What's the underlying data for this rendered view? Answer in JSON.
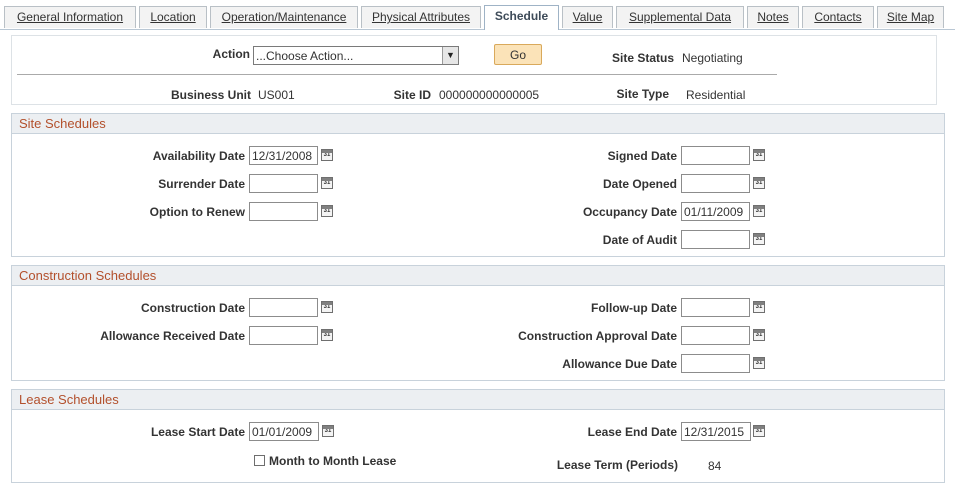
{
  "tabs": [
    {
      "label": "General Information"
    },
    {
      "label": "Location"
    },
    {
      "label": "Operation/Maintenance"
    },
    {
      "label": "Physical Attributes"
    },
    {
      "label": "Schedule"
    },
    {
      "label": "Value"
    },
    {
      "label": "Supplemental Data"
    },
    {
      "label": "Notes"
    },
    {
      "label": "Contacts"
    },
    {
      "label": "Site Map"
    }
  ],
  "header": {
    "action_label": "Action",
    "action_value": "...Choose Action...",
    "go_label": "Go",
    "site_status_label": "Site Status",
    "site_status_value": "Negotiating",
    "business_unit_label": "Business Unit",
    "business_unit_value": "US001",
    "site_id_label": "Site ID",
    "site_id_value": "000000000000005",
    "site_type_label": "Site Type",
    "site_type_value": "Residential"
  },
  "site_schedules": {
    "title": "Site Schedules",
    "availability_date": {
      "label": "Availability Date",
      "value": "12/31/2008"
    },
    "surrender_date": {
      "label": "Surrender Date",
      "value": ""
    },
    "option_to_renew": {
      "label": "Option to Renew",
      "value": ""
    },
    "signed_date": {
      "label": "Signed Date",
      "value": ""
    },
    "date_opened": {
      "label": "Date Opened",
      "value": ""
    },
    "occupancy_date": {
      "label": "Occupancy Date",
      "value": "01/11/2009"
    },
    "date_of_audit": {
      "label": "Date of Audit",
      "value": ""
    }
  },
  "construction_schedules": {
    "title": "Construction Schedules",
    "construction_date": {
      "label": "Construction Date",
      "value": ""
    },
    "allowance_received_date": {
      "label": "Allowance Received Date",
      "value": ""
    },
    "followup_date": {
      "label": "Follow-up Date",
      "value": ""
    },
    "construction_approval_date": {
      "label": "Construction Approval Date",
      "value": ""
    },
    "allowance_due_date": {
      "label": "Allowance Due Date",
      "value": ""
    }
  },
  "lease_schedules": {
    "title": "Lease Schedules",
    "lease_start_date": {
      "label": "Lease Start Date",
      "value": "01/01/2009"
    },
    "lease_end_date": {
      "label": "Lease End Date",
      "value": "12/31/2015"
    },
    "month_to_month_label": "Month to Month Lease",
    "month_to_month_checked": false,
    "lease_term_label": "Lease Term (Periods)",
    "lease_term_value": "84"
  },
  "calendar_icon_glyph": "31",
  "colors": {
    "group_title": "#b3502c",
    "go_button": "#fbe3b8",
    "group_header_bg": "#eceff2"
  }
}
